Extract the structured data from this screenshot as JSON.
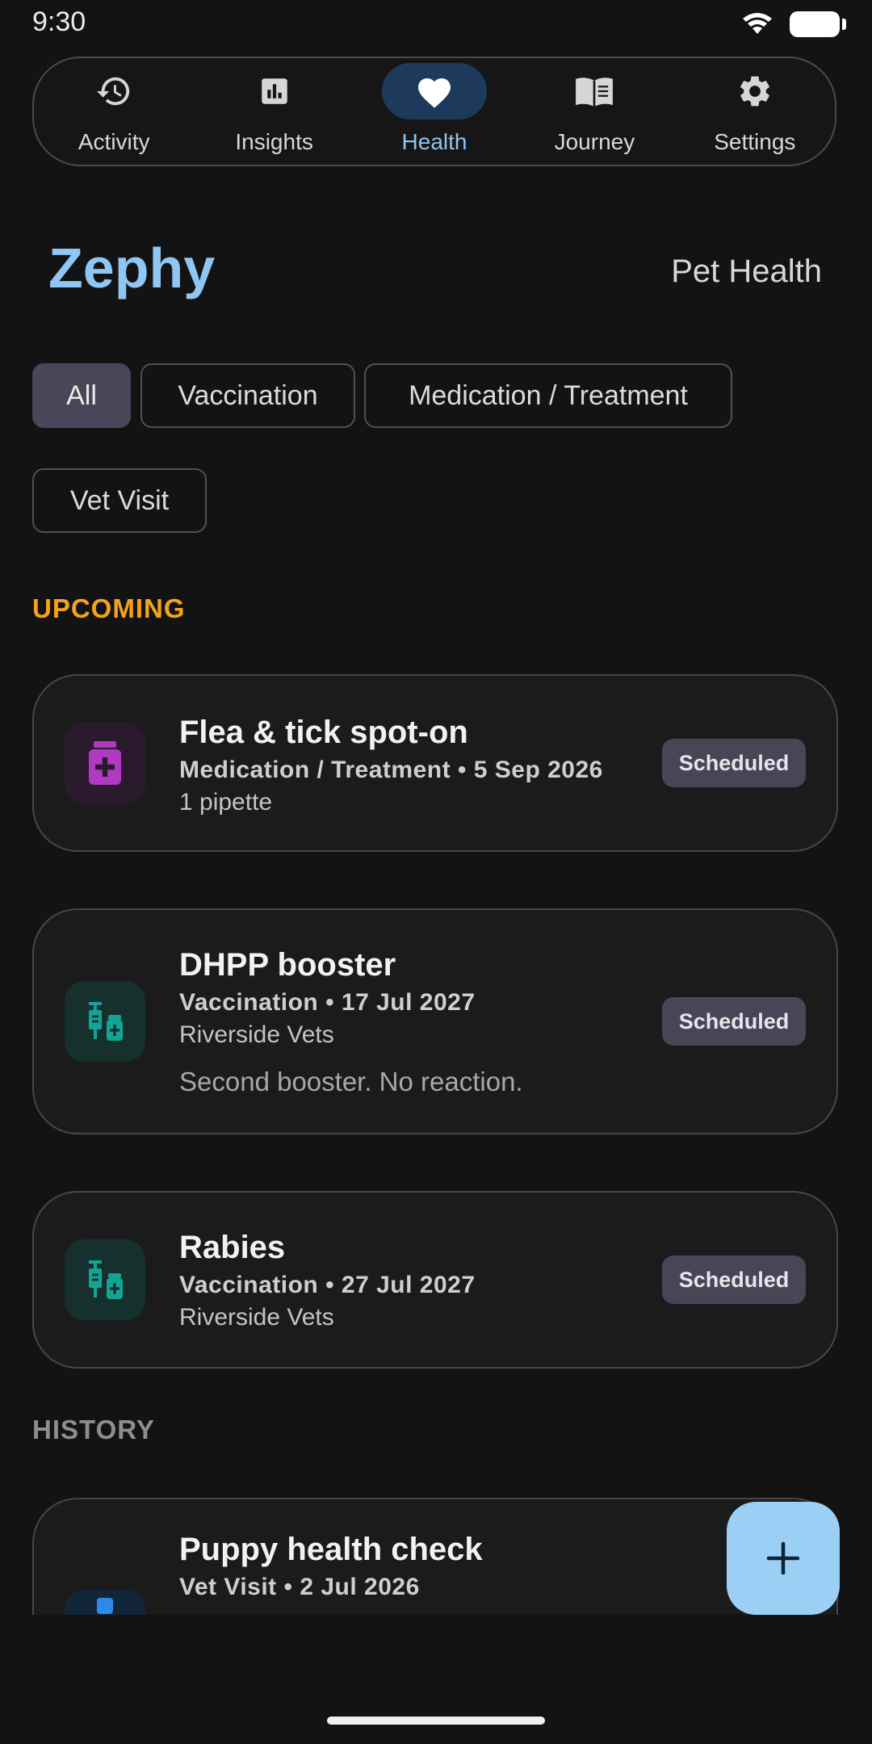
{
  "status": {
    "time": "9:30"
  },
  "nav": [
    {
      "label": "Activity",
      "icon": "history-icon"
    },
    {
      "label": "Insights",
      "icon": "bar-chart-icon"
    },
    {
      "label": "Health",
      "icon": "heart-icon",
      "active": true
    },
    {
      "label": "Journey",
      "icon": "book-icon"
    },
    {
      "label": "Settings",
      "icon": "gear-icon"
    }
  ],
  "header": {
    "pet_name": "Zephy",
    "title": "Pet Health"
  },
  "filters": [
    "All",
    "Vaccination",
    "Medication / Treatment",
    "Vet Visit"
  ],
  "filters_selected": "All",
  "sections": {
    "upcoming": "UPCOMING",
    "history": "HISTORY"
  },
  "cards": [
    {
      "title": "Flea & tick spot-on",
      "subtitle": "Medication / Treatment • 5 Sep 2026",
      "detail": "1 pipette",
      "badge": "Scheduled",
      "icon": "medication-jar-icon"
    },
    {
      "title": "DHPP booster",
      "subtitle": "Vaccination • 17 Jul 2027",
      "detail": "Riverside Vets",
      "note": "Second booster. No reaction.",
      "badge": "Scheduled",
      "icon": "vaccine-icon"
    },
    {
      "title": "Rabies",
      "subtitle": "Vaccination • 27 Jul 2027",
      "detail": "Riverside Vets",
      "badge": "Scheduled",
      "icon": "vaccine-icon"
    },
    {
      "title": "Puppy health check",
      "subtitle": "Vet Visit • 2 Jul 2026",
      "icon": "vet-visit-icon"
    }
  ],
  "fab": {
    "icon": "plus-icon"
  },
  "colors": {
    "accent": "#8fc6f3",
    "upcoming": "#f5a31a",
    "medication": "#b03ac0",
    "vaccine": "#12a596"
  }
}
